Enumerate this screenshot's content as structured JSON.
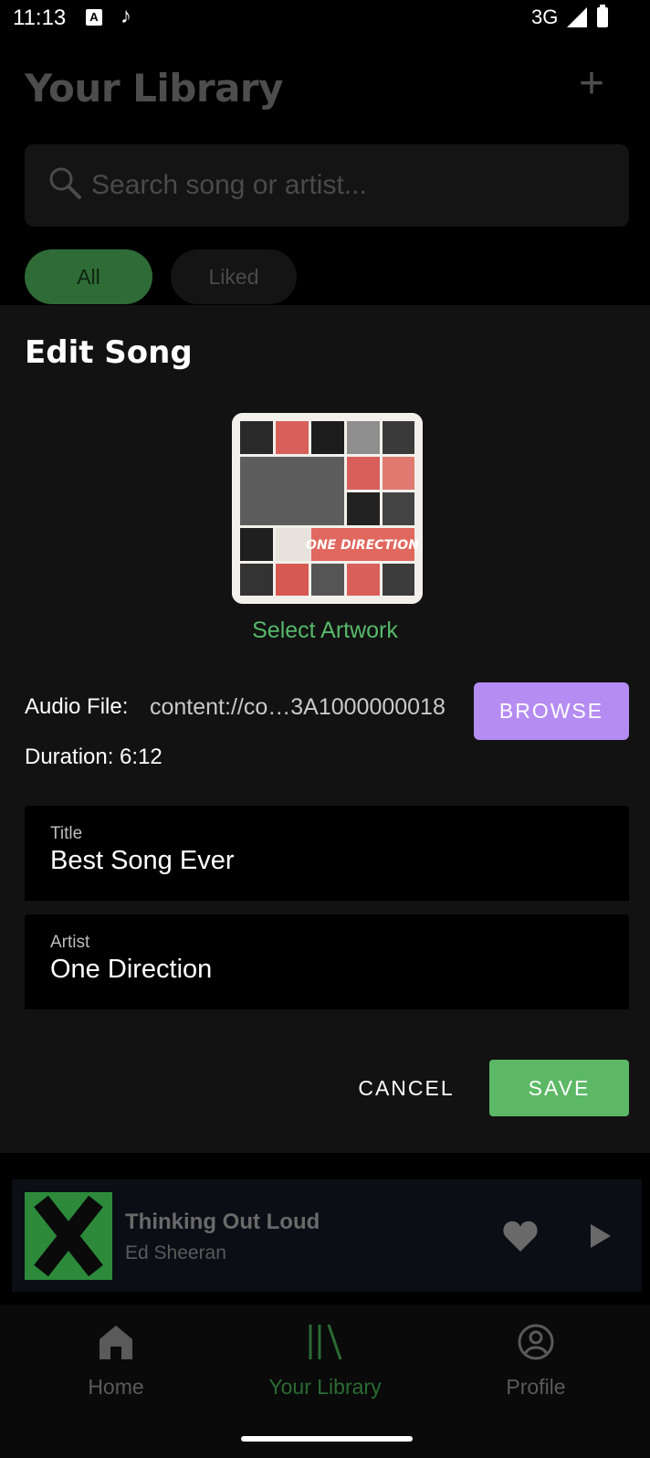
{
  "status_bar": {
    "time": "11:13",
    "network": "3G"
  },
  "background": {
    "title": "Your Library",
    "search_placeholder": "Search song or artist...",
    "filters": [
      "All",
      "Liked"
    ]
  },
  "dialog": {
    "title": "Edit Song",
    "select_artwork": "Select Artwork",
    "artwork_caption": "ONE DIRECTION",
    "audio_label": "Audio File:",
    "audio_value": "content://co…3A1000000018",
    "browse_label": "BROWSE",
    "duration": "Duration: 6:12",
    "fields": {
      "title": {
        "label": "Title",
        "value": "Best Song Ever"
      },
      "artist": {
        "label": "Artist",
        "value": "One Direction"
      }
    },
    "cancel_label": "CANCEL",
    "save_label": "SAVE"
  },
  "mini_player": {
    "title": "Thinking Out Loud",
    "artist": "Ed Sheeran",
    "liked": true
  },
  "nav": {
    "items": [
      {
        "label": "Home",
        "icon": "home-icon",
        "active": false
      },
      {
        "label": "Your Library",
        "icon": "library-icon",
        "active": true
      },
      {
        "label": "Profile",
        "icon": "profile-icon",
        "active": false
      }
    ]
  },
  "colors": {
    "accent_green": "#5cb865",
    "browse_purple": "#b58cf2",
    "sheet_bg": "#121212"
  }
}
